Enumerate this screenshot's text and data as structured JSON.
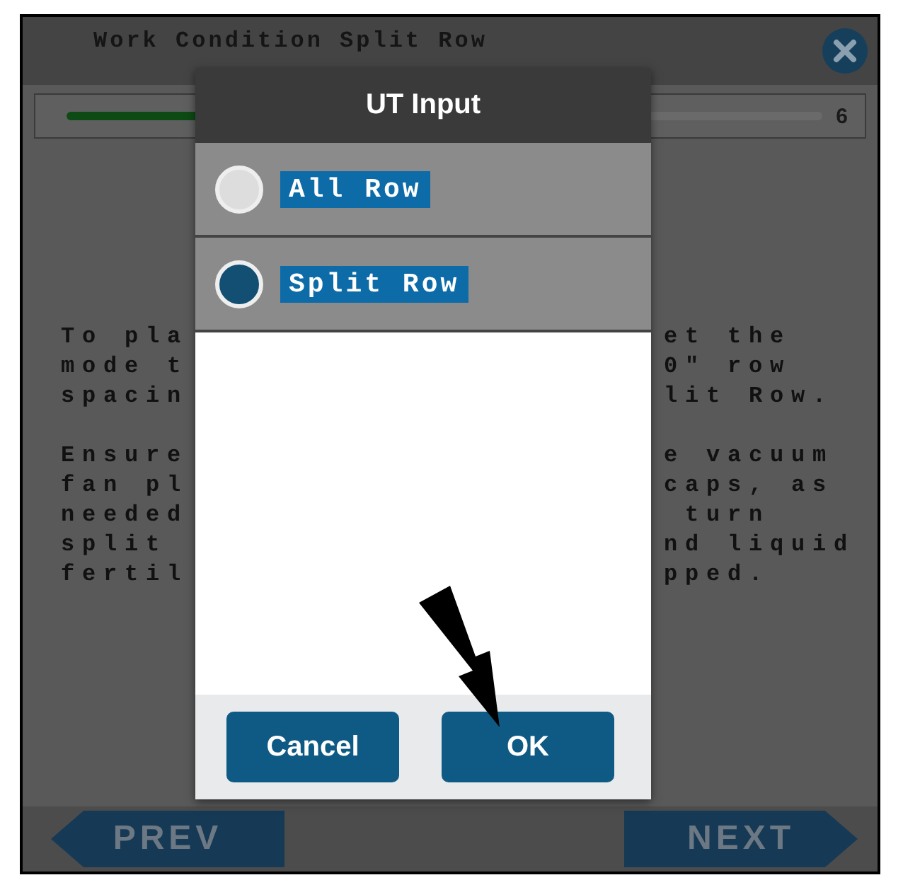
{
  "screen": {
    "title": "Work Condition Split Row",
    "progress": {
      "level": 0.2,
      "reading": "6"
    },
    "paragraphs": [
      [
        {
          "left": "To pla",
          "right": "et the"
        },
        {
          "left": "mode t",
          "right": "0\" row"
        },
        {
          "left": "spacin",
          "right": "lit Row."
        }
      ],
      [
        {
          "left": "Ensure",
          "right": "e vacuum"
        },
        {
          "left": "fan pl",
          "right": "caps, as"
        },
        {
          "left": "needed",
          "right": " turn"
        },
        {
          "left": "split",
          "right": "nd liquid"
        },
        {
          "left": "fertil",
          "right": "pped."
        }
      ]
    ],
    "nav": [
      {
        "label": "PREV",
        "kind": "back"
      },
      {
        "label": "NEXT",
        "kind": "forward"
      }
    ]
  },
  "dialog": {
    "title": "UT Input",
    "options": [
      {
        "label": "All Row",
        "selected": false
      },
      {
        "label": "Split Row",
        "selected": true
      }
    ],
    "buttons": [
      "Cancel",
      "OK"
    ]
  }
}
